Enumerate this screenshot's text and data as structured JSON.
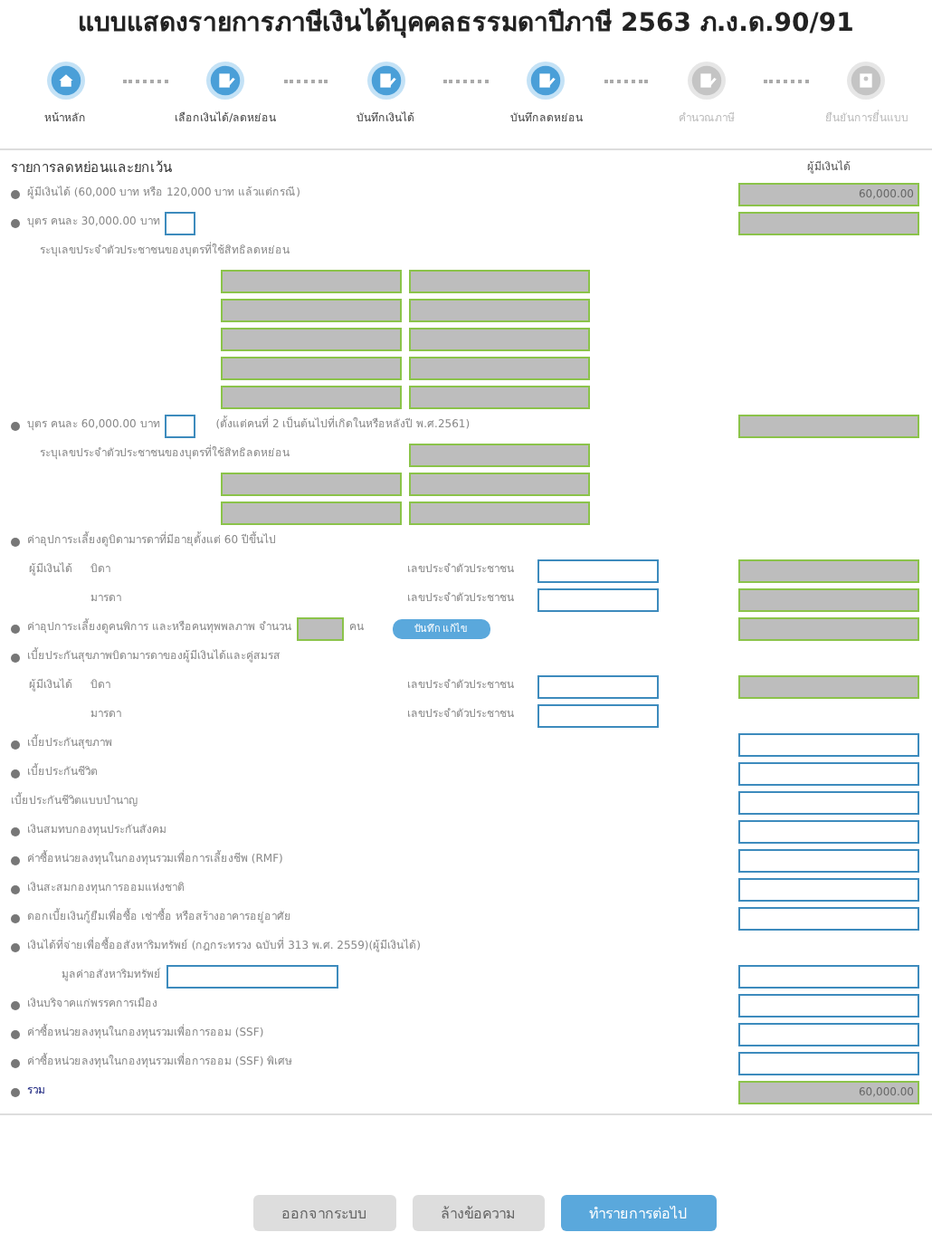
{
  "title": "แบบแสดงรายการภาษีเงินได้บุคคลธรรมดาปีภาษี 2563 ภ.ง.ด.90/91",
  "steps": [
    {
      "label": "หน้าหลัก",
      "kind": "home",
      "active": true
    },
    {
      "label": "เลือกเงินได้/ลดหย่อน",
      "kind": "edit",
      "active": true
    },
    {
      "label": "บันทึกเงินได้",
      "kind": "edit",
      "active": true
    },
    {
      "label": "บันทึกลดหย่อน",
      "kind": "edit",
      "active": true
    },
    {
      "label": "คำนวณภาษี",
      "kind": "edit",
      "active": false
    },
    {
      "label": "ยืนยันการยื่นแบบ",
      "kind": "confirm",
      "active": false
    }
  ],
  "section": {
    "title": "รายการลดหย่อนและยกเว้น",
    "column": "ผู้มีเงินได้"
  },
  "rows": [
    {
      "kind": "item",
      "bullet": true,
      "label": "ผู้มีเงินได้ (60,000 บาท หรือ 120,000 บาท แล้วแต่กรณี)",
      "amount": {
        "kind": "readonly",
        "value": "60,000.00"
      }
    },
    {
      "kind": "item",
      "bullet": true,
      "label": "บุตร คนละ 30,000.00 บาท",
      "count": {
        "kind": "input"
      },
      "amount": {
        "kind": "readonly"
      }
    },
    {
      "kind": "note",
      "label": "ระบุเลขประจำตัวประชาชนของบุตรที่ใช้สิทธิลดหย่อน",
      "ids": []
    },
    {
      "kind": "idgrid",
      "ids": [
        {
          "kind": "readonly"
        },
        {
          "kind": "readonly"
        }
      ]
    },
    {
      "kind": "idgrid",
      "ids": [
        {
          "kind": "readonly"
        },
        {
          "kind": "readonly"
        }
      ]
    },
    {
      "kind": "idgrid",
      "ids": [
        {
          "kind": "readonly"
        },
        {
          "kind": "readonly"
        }
      ]
    },
    {
      "kind": "idgrid",
      "ids": [
        {
          "kind": "readonly"
        },
        {
          "kind": "readonly"
        }
      ]
    },
    {
      "kind": "idgrid",
      "ids": [
        {
          "kind": "readonly"
        },
        {
          "kind": "readonly"
        }
      ]
    },
    {
      "kind": "item",
      "bullet": true,
      "label": "บุตร คนละ 60,000.00 บาท",
      "count": {
        "kind": "input"
      },
      "note": "(ตั้งแต่คนที่ 2 เป็นต้นไปที่เกิดในหรือหลังปี พ.ศ.2561)",
      "amount": {
        "kind": "readonly"
      }
    },
    {
      "kind": "note",
      "label": "ระบุเลขประจำตัวประชาชนของบุตรที่ใช้สิทธิลดหย่อน",
      "ids": [
        {
          "kind": "readonly"
        }
      ]
    },
    {
      "kind": "idgrid",
      "ids": [
        {
          "kind": "readonly"
        },
        {
          "kind": "readonly"
        }
      ]
    },
    {
      "kind": "idgrid",
      "ids": [
        {
          "kind": "readonly"
        },
        {
          "kind": "readonly"
        }
      ]
    },
    {
      "kind": "item",
      "bullet": true,
      "label": "ค่าอุปการะเลี้ยงดูบิดามารดาที่มีอายุตั้งแต่ 60 ปีขึ้นไป"
    },
    {
      "kind": "person",
      "holder": "ผู้มีเงินได้",
      "relation": "บิดา",
      "id_label": "เลขประจำตัวประชาชน",
      "amount": {
        "kind": "readonly"
      }
    },
    {
      "kind": "person",
      "relation": "มารดา",
      "id_label": "เลขประจำตัวประชาชน",
      "amount": {
        "kind": "readonly"
      }
    },
    {
      "kind": "item",
      "bullet": true,
      "label": "ค่าอุปการะเลี้ยงดูคนพิการ และหรือคนทุพพลภาพ จำนวน",
      "count": {
        "kind": "readonly"
      },
      "unit": "คน",
      "button": "บันทึก แก้ไข",
      "amount": {
        "kind": "readonly"
      }
    },
    {
      "kind": "item",
      "bullet": true,
      "label": "เบี้ยประกันสุขภาพบิดามารดาของผู้มีเงินได้และคู่สมรส"
    },
    {
      "kind": "person",
      "holder": "ผู้มีเงินได้",
      "relation": "บิดา",
      "id_label": "เลขประจำตัวประชาชน",
      "amount": {
        "kind": "readonly"
      }
    },
    {
      "kind": "person",
      "relation": "มารดา",
      "id_label": "เลขประจำตัวประชาชน"
    },
    {
      "kind": "item",
      "bullet": true,
      "label": "เบี้ยประกันสุขภาพ",
      "amount": {
        "kind": "input"
      }
    },
    {
      "kind": "item",
      "bullet": true,
      "label": "เบี้ยประกันชีวิต",
      "amount": {
        "kind": "input"
      }
    },
    {
      "kind": "item",
      "bullet": false,
      "label": "เบี้ยประกันชีวิตแบบบำนาญ",
      "amount": {
        "kind": "input"
      }
    },
    {
      "kind": "item",
      "bullet": true,
      "label": "เงินสมทบกองทุนประกันสังคม",
      "amount": {
        "kind": "input"
      }
    },
    {
      "kind": "item",
      "bullet": true,
      "label": "ค่าซื้อหน่วยลงทุนในกองทุนรวมเพื่อการเลี้ยงชีพ (RMF)",
      "amount": {
        "kind": "input"
      }
    },
    {
      "kind": "item",
      "bullet": true,
      "label": "เงินสะสมกองทุนการออมแห่งชาติ",
      "amount": {
        "kind": "input"
      }
    },
    {
      "kind": "item",
      "bullet": true,
      "label": "ดอกเบี้ยเงินกู้ยืมเพื่อซื้อ เช่าซื้อ หรือสร้างอาคารอยู่อาศัย",
      "amount": {
        "kind": "input"
      }
    },
    {
      "kind": "item",
      "bullet": true,
      "label": "เงินได้ที่จ่ายเพื่อซื้ออสังหาริมทรัพย์ (กฎกระทรวง ฉบับที่ 313 พ.ศ. 2559)(ผู้มีเงินได้)"
    },
    {
      "kind": "valuefield",
      "label": "มูลค่าอสังหาริมทรัพย์",
      "amount": {
        "kind": "input"
      }
    },
    {
      "kind": "item",
      "bullet": true,
      "label": "เงินบริจาคแก่พรรคการเมือง",
      "amount": {
        "kind": "input"
      }
    },
    {
      "kind": "item",
      "bullet": true,
      "label": "ค่าซื้อหน่วยลงทุนในกองทุนรวมเพื่อการออม (SSF)",
      "amount": {
        "kind": "input"
      }
    },
    {
      "kind": "item",
      "bullet": true,
      "label": "ค่าซื้อหน่วยลงทุนในกองทุนรวมเพื่อการออม (SSF) พิเศษ",
      "amount": {
        "kind": "input"
      }
    },
    {
      "kind": "total",
      "bullet": true,
      "label": "รวม",
      "amount": {
        "kind": "readonly",
        "value": "60,000.00"
      }
    }
  ],
  "buttons": [
    {
      "label": "ออกจากระบบ",
      "kind": "secondary"
    },
    {
      "label": "ล้างข้อความ",
      "kind": "secondary"
    },
    {
      "label": "ทำรายการต่อไป",
      "kind": "primary"
    }
  ]
}
